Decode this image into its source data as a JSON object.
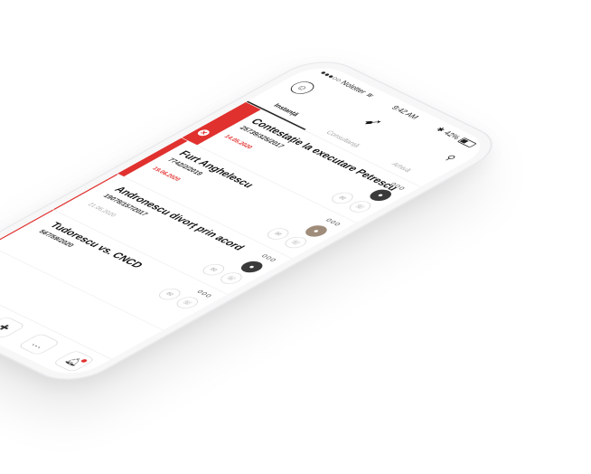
{
  "status": {
    "carrier": "●●●○○ Noletter",
    "wifi_icon": "wifi-icon",
    "time": "9:42 AM",
    "bluetooth": "✱",
    "battery": "42%"
  },
  "header": {
    "logo_icon": "bird-logo-icon",
    "avatar_icon": "user-avatar-icon",
    "search_icon": "search-icon"
  },
  "tabs": [
    {
      "label": "Instanță",
      "active": true
    },
    {
      "label": "Consultanță",
      "active": false
    },
    {
      "label": "Arhivă",
      "active": false
    }
  ],
  "cases": [
    {
      "title": "Contestație la executare Petrescu",
      "code": "25739/325/2017",
      "date": "14.05.2020",
      "date_color": "red",
      "marker": "solid-alert",
      "more": "ooo",
      "assignee_icon": "person-avatar-icon"
    },
    {
      "title": "Furt Anghelescu",
      "code": "7742/2/2019",
      "date": "19.06.2020",
      "date_color": "red",
      "marker": "solid",
      "more": "ooo",
      "assignee_icon": "person-avatar-icon"
    },
    {
      "title": "Andronescu divorț prin acord",
      "code": "19078/157/2017",
      "date": "21.06.2020",
      "date_color": "grey",
      "marker": "line",
      "more": "ooo",
      "assignee_icon": "person-avatar-icon"
    },
    {
      "title": "Tudorescu vs. CNCD",
      "code": "567/59/2020",
      "date": "",
      "date_color": "grey",
      "marker": "line",
      "more": "ooo",
      "assignee_icon": ""
    }
  ],
  "tabbar": {
    "home_icon": "home-icon",
    "book_icon": "book-icon",
    "medical_cross_icon": "cross-icon",
    "chat_icon": "chat-icon",
    "notification_icon": "bell-icon"
  },
  "colors": {
    "accent": "#e0312f"
  }
}
